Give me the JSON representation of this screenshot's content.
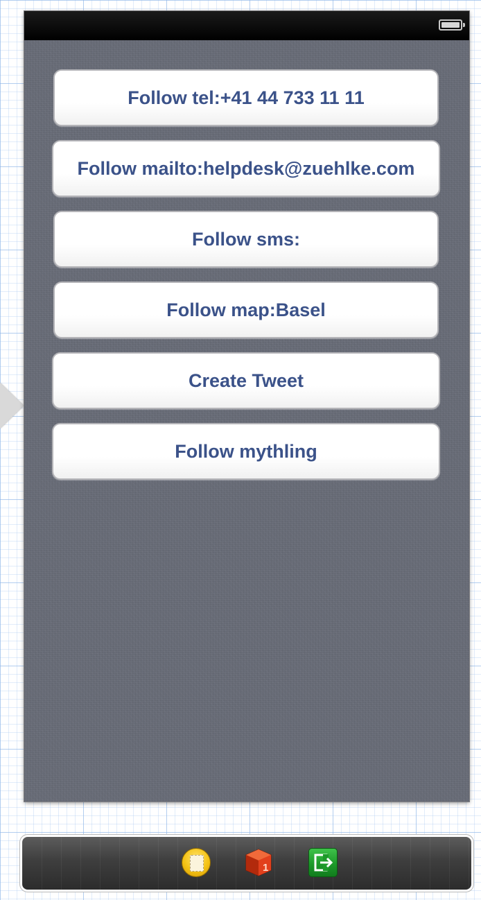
{
  "status_bar": {
    "battery_icon": "battery-full-icon"
  },
  "buttons": [
    {
      "label": "Follow tel:+41 44 733 11 11"
    },
    {
      "label": "Follow mailto:helpdesk@zuehlke.com"
    },
    {
      "label": "Follow sms:"
    },
    {
      "label": "Follow map:Basel"
    },
    {
      "label": "Create Tweet"
    },
    {
      "label": "Follow mythling"
    }
  ],
  "dock": {
    "icons": [
      {
        "name": "view-controller-icon"
      },
      {
        "name": "first-responder-icon",
        "badge": "1"
      },
      {
        "name": "exit-icon"
      }
    ]
  },
  "colors": {
    "button_text": "#3b5289",
    "background": "#676b76",
    "status_bar": "#000000",
    "exit_icon": "#1d9a2a",
    "view_controller_icon": "#f4c214",
    "first_responder_icon": "#e2401c"
  }
}
